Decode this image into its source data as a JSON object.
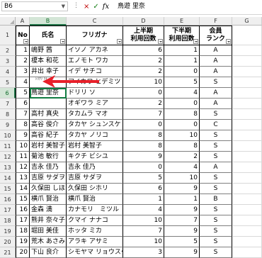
{
  "formula_bar": {
    "name_box": "B6",
    "cancel_icon": "×",
    "enter_icon": "✓",
    "fx_label": "fx",
    "content": "鳥遊 里奈"
  },
  "columns": [
    "A",
    "B",
    "C",
    "D",
    "E",
    "F",
    "G"
  ],
  "row_numbers": [
    "1",
    "2",
    "3",
    "4",
    "5",
    "6",
    "7",
    "8",
    "9",
    "10",
    "11",
    "12",
    "13",
    "14",
    "15",
    "16",
    "17",
    "18",
    "19",
    "20",
    "21"
  ],
  "table_header": {
    "no": "No",
    "name": "氏名",
    "kana": "フリガナ",
    "first_half_1": "上半期",
    "first_half_2": "利用回数",
    "second_half_1": "下半期",
    "second_half_2": "利用回数",
    "rank_1": "会員",
    "rank_2": "ランク"
  },
  "rows": [
    {
      "no": "1",
      "name": "嶋野 茜",
      "kana": "イソノ アカネ",
      "h1": "6",
      "h2": "1",
      "rank": "A"
    },
    {
      "no": "2",
      "name": "榎本 和花",
      "kana": "エノモト ワカ",
      "h1": "2",
      "h2": "1",
      "rank": "A"
    },
    {
      "no": "3",
      "name": "井出 幸子",
      "kana": "イデ サチコ",
      "h1": "2",
      "h2": "0",
      "rank": "A"
    },
    {
      "no": "4",
      "name": "",
      "kana": "アイカワ ヒデミツ",
      "h1": "10",
      "h2": "5",
      "rank": "S"
    },
    {
      "no": "5",
      "name": "鳥遊 里奈",
      "kana": "ドリリ ソ",
      "h1": "0",
      "h2": "4",
      "rank": "A"
    },
    {
      "no": "6",
      "name": "",
      "kana": "オギワラ ミア",
      "h1": "2",
      "h2": "0",
      "rank": "A"
    },
    {
      "no": "7",
      "name": "高村 真央",
      "kana": "タカムラ マオ",
      "h1": "7",
      "h2": "8",
      "rank": "S"
    },
    {
      "no": "8",
      "name": "高谷 俊介",
      "kana": "タカヤ シュンスケ",
      "h1": "0",
      "h2": "0",
      "rank": "C"
    },
    {
      "no": "9",
      "name": "高谷 紀子",
      "kana": "タカヤ ノリコ",
      "h1": "8",
      "h2": "10",
      "rank": "S"
    },
    {
      "no": "10",
      "name": "岩村 美智子",
      "kana": "岩村 美智子",
      "h1": "8",
      "h2": "8",
      "rank": "S"
    },
    {
      "no": "11",
      "name": "菊池 敏行",
      "kana": "キクチ ビシユ",
      "h1": "9",
      "h2": "2",
      "rank": "S"
    },
    {
      "no": "12",
      "name": "吉永 佳乃",
      "kana": "吉永 佳乃",
      "h1": "0",
      "h2": "4",
      "rank": "A"
    },
    {
      "no": "13",
      "name": "吉原 サダヲ",
      "kana": "吉原 サダヲ",
      "h1": "5",
      "h2": "10",
      "rank": "S"
    },
    {
      "no": "14",
      "name": "久保田 しほり",
      "kana": "久保田 シホリ",
      "h1": "6",
      "h2": "9",
      "rank": "S"
    },
    {
      "no": "15",
      "name": "横爪 賢治",
      "kana": "横爪 賢治",
      "h1": "1",
      "h2": "1",
      "rank": "B"
    },
    {
      "no": "16",
      "name": "金森 満",
      "kana": "カナモリ　ミツル",
      "h1": "4",
      "h2": "9",
      "rank": "S"
    },
    {
      "no": "17",
      "name": "熊井 奈々子",
      "kana": "クマイ ナナコ",
      "h1": "10",
      "h2": "7",
      "rank": "S"
    },
    {
      "no": "18",
      "name": "堀田 美佳",
      "kana": "ホッタ ミカ",
      "h1": "7",
      "h2": "9",
      "rank": "S"
    },
    {
      "no": "19",
      "name": "荒木 あさみ",
      "kana": "アラキ アサミ",
      "h1": "10",
      "h2": "5",
      "rank": "S"
    },
    {
      "no": "20",
      "name": "下山 良介",
      "kana": "シモヤマ リョウスケ",
      "h1": "3",
      "h2": "9",
      "rank": "S"
    }
  ],
  "furigana_overlay": "ﾄﾘｱｿ ﾘﾅ",
  "colors": {
    "selection": "#107c41",
    "arrow": "#e8202a",
    "header_bg": "#efefef"
  }
}
